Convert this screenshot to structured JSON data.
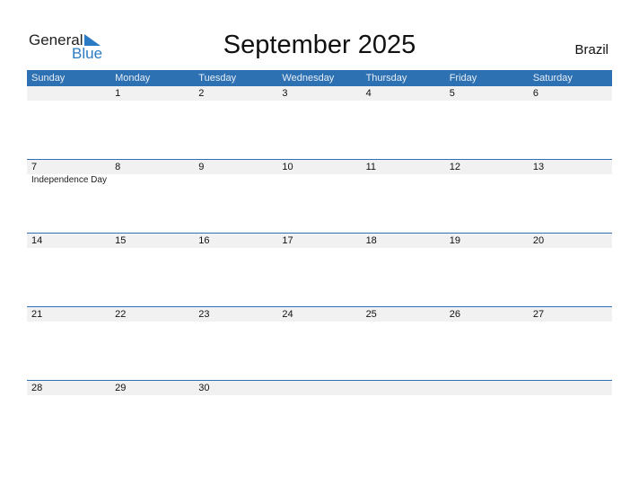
{
  "logo": {
    "general": "General",
    "blue": "Blue"
  },
  "title": "September 2025",
  "country": "Brazil",
  "weekdays": [
    "Sunday",
    "Monday",
    "Tuesday",
    "Wednesday",
    "Thursday",
    "Friday",
    "Saturday"
  ],
  "weeks": [
    {
      "days": [
        "",
        "1",
        "2",
        "3",
        "4",
        "5",
        "6"
      ],
      "events": [
        "",
        "",
        "",
        "",
        "",
        "",
        ""
      ]
    },
    {
      "days": [
        "7",
        "8",
        "9",
        "10",
        "11",
        "12",
        "13"
      ],
      "events": [
        "Independence Day",
        "",
        "",
        "",
        "",
        "",
        ""
      ]
    },
    {
      "days": [
        "14",
        "15",
        "16",
        "17",
        "18",
        "19",
        "20"
      ],
      "events": [
        "",
        "",
        "",
        "",
        "",
        "",
        ""
      ]
    },
    {
      "days": [
        "21",
        "22",
        "23",
        "24",
        "25",
        "26",
        "27"
      ],
      "events": [
        "",
        "",
        "",
        "",
        "",
        "",
        ""
      ]
    },
    {
      "days": [
        "28",
        "29",
        "30",
        "",
        "",
        "",
        ""
      ],
      "events": [
        "",
        "",
        "",
        "",
        "",
        "",
        ""
      ]
    }
  ],
  "colors": {
    "accent": "#2e71b3",
    "logo_blue": "#2a7bc4",
    "day_strip": "#f1f1f1"
  }
}
